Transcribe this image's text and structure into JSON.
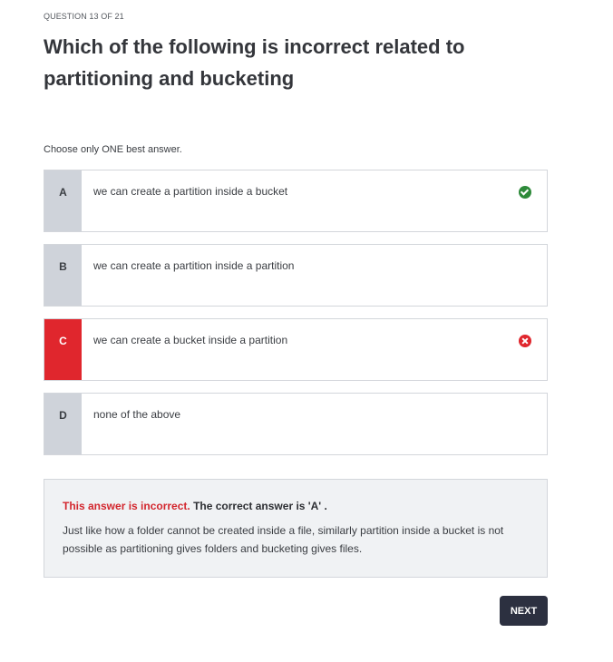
{
  "quiz": {
    "progress": "QUESTION 13 OF 21",
    "question": "Which of the following is incorrect related to partitioning and bucketing",
    "instruction": "Choose only ONE best answer."
  },
  "options": [
    {
      "letter": "A",
      "text": "we can create a partition inside a bucket",
      "status": "correct"
    },
    {
      "letter": "B",
      "text": "we can create a partition inside a partition",
      "status": "none"
    },
    {
      "letter": "C",
      "text": "we can create a bucket inside a partition",
      "status": "selected-wrong"
    },
    {
      "letter": "D",
      "text": "none of the above",
      "status": "none"
    }
  ],
  "feedback": {
    "incorrect_label": "This answer is incorrect.",
    "correct_answer": "The correct answer is 'A' .",
    "explanation": "Just like how a folder cannot be created inside a file, similarly partition inside a bucket is not possible as partitioning  gives folders and bucketing gives files."
  },
  "actions": {
    "next_label": "NEXT"
  },
  "icons": {
    "correct": "check-circle-icon",
    "wrong": "x-circle-icon"
  },
  "colors": {
    "wrong_accent": "#e0262d",
    "correct_accent": "#2e8a3a",
    "next_button": "#2c3040"
  }
}
